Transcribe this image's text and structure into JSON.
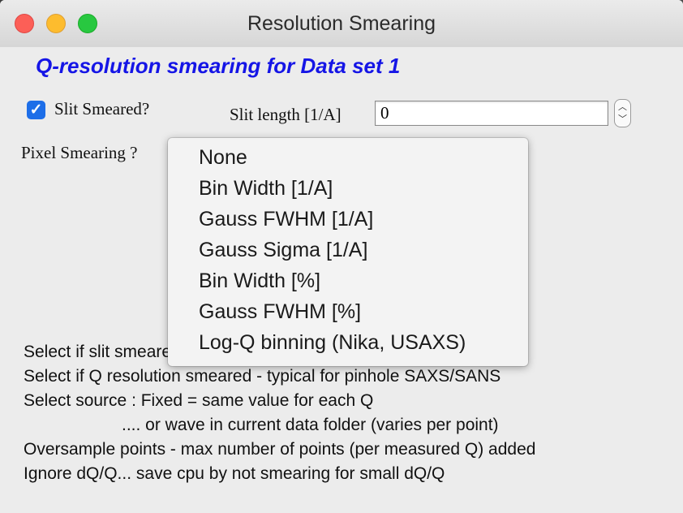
{
  "window": {
    "title": "Resolution Smearing"
  },
  "panel": {
    "heading": "Q-resolution smearing for Data set 1",
    "slit_smeared": {
      "checked": true,
      "label": "Slit Smeared?"
    },
    "slit_length": {
      "label": "Slit length [1/A]",
      "value": "0"
    },
    "pixel_smearing": {
      "label": "Pixel Smearing ?"
    },
    "help_lines": [
      "Select if slit smeared",
      "Select if Q resolution smeared - typical for pinhole SAXS/SANS",
      "Select source : Fixed = same value for each Q",
      ".... or wave in current data folder (varies per point)",
      "Oversample points - max number of points (per measured Q) added",
      "Ignore dQ/Q... save cpu by not smearing for small dQ/Q"
    ]
  },
  "dropdown_menu": {
    "items": [
      "None",
      "Bin Width [1/A]",
      "Gauss FWHM [1/A]",
      "Gauss Sigma [1/A]",
      "Bin Width [%]",
      "Gauss FWHM [%]",
      "Log-Q binning (Nika, USAXS)"
    ]
  }
}
